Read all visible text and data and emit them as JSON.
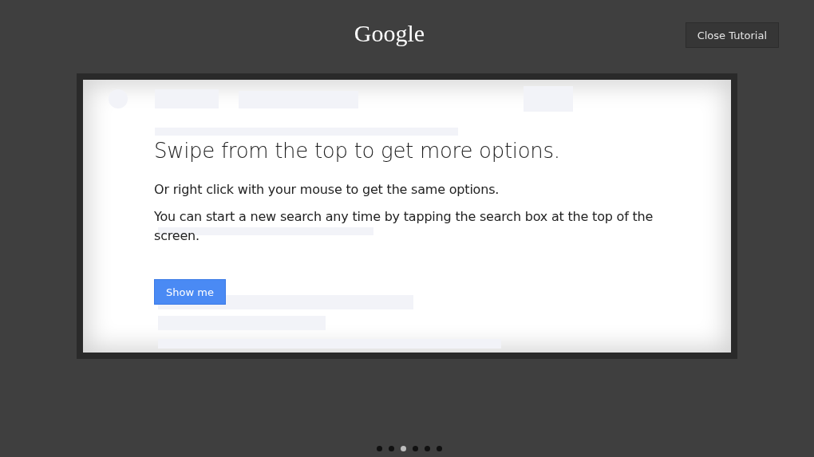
{
  "header": {
    "logo": "Google",
    "close_button": "Close Tutorial"
  },
  "card": {
    "title": "Swipe from the top to get more options.",
    "paragraphs": [
      "Or right click with your mouse to get the same options.",
      "You can start a new search any time by tapping the search box at the top of the screen."
    ],
    "button": "Show me"
  },
  "pager": [
    {
      "selected": false
    },
    {
      "selected": false
    },
    {
      "selected": true
    },
    {
      "selected": false
    },
    {
      "selected": false
    },
    {
      "selected": false
    }
  ]
}
